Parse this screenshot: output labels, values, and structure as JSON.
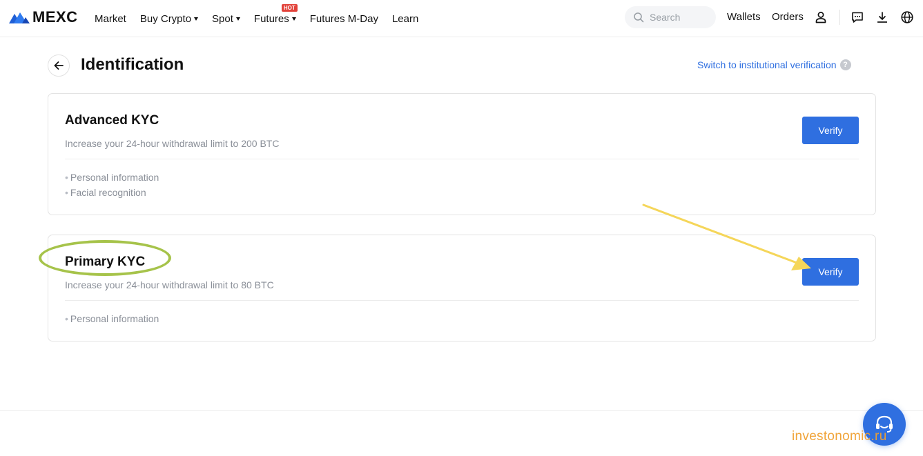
{
  "brand": {
    "name": "MEXC",
    "accent": "#2f6fe0",
    "hot_color": "#e2423a"
  },
  "nav": {
    "items": [
      {
        "label": "Market",
        "dropdown": false
      },
      {
        "label": "Buy Crypto",
        "dropdown": true
      },
      {
        "label": "Spot",
        "dropdown": true
      },
      {
        "label": "Futures",
        "dropdown": true,
        "badge": "HOT"
      },
      {
        "label": "Futures M-Day",
        "dropdown": false
      },
      {
        "label": "Learn",
        "dropdown": false
      }
    ]
  },
  "search": {
    "placeholder": "Search",
    "icon": "search-icon"
  },
  "header_right": {
    "wallets": "Wallets",
    "orders": "Orders",
    "icons": [
      "user-icon",
      "chat-icon",
      "download-icon",
      "globe-icon"
    ]
  },
  "page": {
    "title": "Identification",
    "institutional_link": "Switch to institutional verification",
    "help_glyph": "?"
  },
  "cards": [
    {
      "title": "Advanced KYC",
      "description": "Increase your 24-hour withdrawal limit to 200 BTC",
      "features": [
        "Personal information",
        "Facial recognition"
      ],
      "button": "Verify"
    },
    {
      "title": "Primary KYC",
      "description": "Increase your 24-hour withdrawal limit to 80 BTC",
      "features": [
        "Personal information"
      ],
      "button": "Verify"
    }
  ],
  "annotations": {
    "highlight_color": "#a6c34a",
    "arrow_color": "#f5d65a"
  },
  "watermark": "investonomic.ru"
}
